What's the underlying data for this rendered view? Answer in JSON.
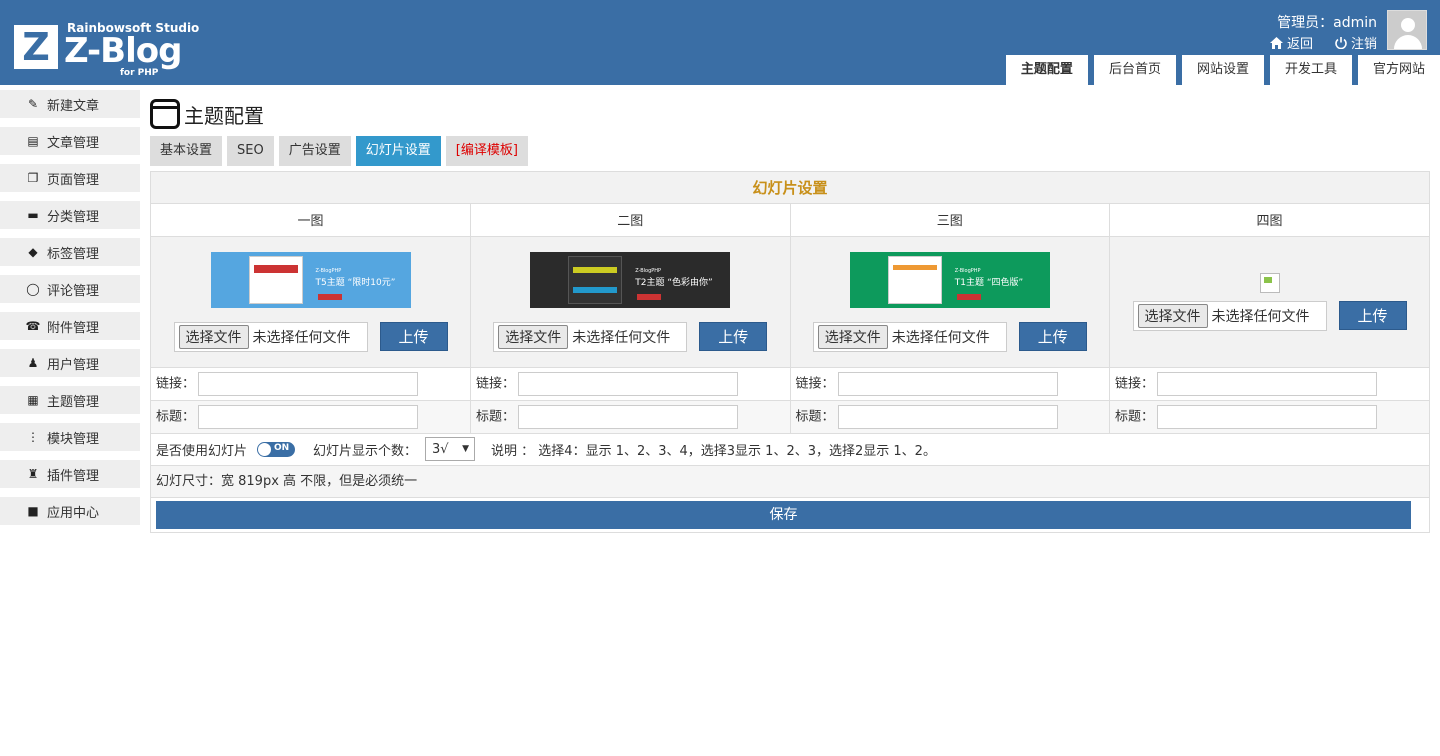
{
  "logo": {
    "letter": "Z",
    "studio": "Rainbowsoft Studio",
    "name": "Z-Blog",
    "php": "for PHP"
  },
  "user": {
    "line": "管理员：admin",
    "back": "返回",
    "logout": "注销"
  },
  "top_tabs": [
    "主题配置",
    "后台首页",
    "网站设置",
    "开发工具",
    "官方网站"
  ],
  "sidebar": [
    {
      "label": "新建文章"
    },
    {
      "label": "文章管理"
    },
    {
      "label": "页面管理"
    },
    {
      "label": "分类管理"
    },
    {
      "label": "标签管理"
    },
    {
      "label": "评论管理"
    },
    {
      "label": "附件管理"
    },
    {
      "label": "用户管理"
    },
    {
      "label": "主题管理"
    },
    {
      "label": "模块管理"
    },
    {
      "label": "插件管理"
    },
    {
      "label": "应用中心"
    }
  ],
  "page": {
    "title": "主题配置",
    "tabs": [
      "基本设置",
      "SEO",
      "广告设置",
      "幻灯片设置",
      "[编译模板]"
    ],
    "panel_title": "幻灯片设置",
    "columns": [
      "一图",
      "二图",
      "三图",
      "四图"
    ],
    "slides": [
      {
        "caption": "T5主题 “限时10元”",
        "bg": "#55a6e0"
      },
      {
        "caption": "T2主题 “色彩由你”",
        "bg": "#2b2b2b"
      },
      {
        "caption": "T1主题 “四色版”",
        "bg": "#0d9a5c"
      }
    ],
    "file_button": "选择文件",
    "file_none": "未选择任何文件",
    "upload": "上传",
    "link_label": "链接：",
    "title_label": "标题：",
    "use_slide": "是否使用幻灯片",
    "toggle": "ON",
    "count_label": "幻灯片显示个数：",
    "count_value": "3√",
    "note": "说明 ： 选择4：显示 1、2、3、4，选择3显示 1、2、3，选择2显示 1、2。",
    "size_note": "幻灯尺寸：宽 819px 高 不限，但是必须统一",
    "save": "保存"
  }
}
